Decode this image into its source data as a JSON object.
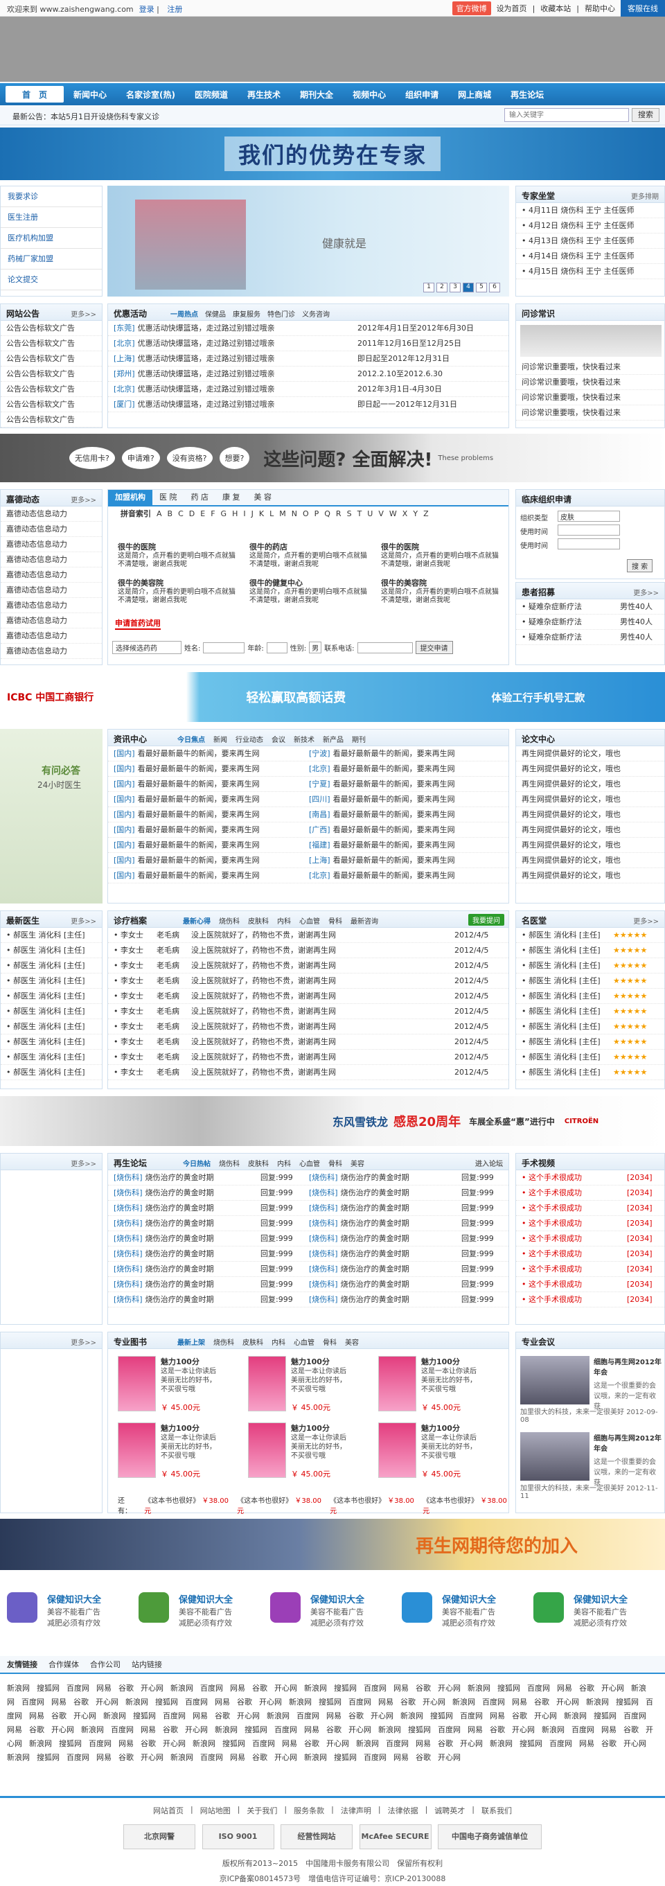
{
  "topbar": {
    "welcome": "欢迎来到 www.zaishengwang.com",
    "login": "登录",
    "register": "注册",
    "weibo": "官方微博",
    "homepage": "设为首页",
    "favorite": "收藏本站",
    "help": "帮助中心",
    "service": "客服在线"
  },
  "nav": [
    "首　页",
    "新闻中心",
    "名家诊室(热)",
    "医院频道",
    "再生技术",
    "期刊大全",
    "视频中心",
    "组织申请",
    "网上商城",
    "再生论坛"
  ],
  "announce": "最新公告：本站5月1日开设烧伤科专家义诊",
  "search": {
    "placeholder": "输入关键字",
    "button": "搜索"
  },
  "hero": "我们的优势在专家",
  "side_menu": [
    "我要求诊",
    "医生注册",
    "医疗机构加盟",
    "药械厂家加盟",
    "论文提交"
  ],
  "slider": {
    "caption": "健康就是",
    "pages": [
      "1",
      "2",
      "3",
      "4",
      "5",
      "6"
    ]
  },
  "expert": {
    "title": "专家坐堂",
    "tab2": "更多排期",
    "items": [
      "• 4月11日 烧伤科 王宁 主任医师",
      "• 4月12日 烧伤科 王宁 主任医师",
      "• 4月13日 烧伤科 王宁 主任医师",
      "• 4月14日 烧伤科 王宁 主任医师",
      "• 4月15日 烧伤科 王宁 主任医师"
    ]
  },
  "site_notice": {
    "title": "网站公告",
    "more": "更多>>",
    "items": [
      "公告公告标软文广告",
      "公告公告标软文广告",
      "公告公告标软文广告",
      "公告公告标软文广告",
      "公告公告标软文广告",
      "公告公告标软文广告",
      "公告公告标软文广告"
    ]
  },
  "promo": {
    "title": "优惠活动",
    "tabs": [
      "一周热点",
      "保健品",
      "康复服务",
      "特色门诊",
      "义务咨询"
    ],
    "items": [
      {
        "tag": "[东莞]",
        "text": "优惠活动快爆篮珞，走过路过别错过哦亲",
        "date": "2012年4月1日至2012年6月30日"
      },
      {
        "tag": "[北京]",
        "text": "优惠活动快爆篮珞，走过路过别错过哦亲",
        "date": "2011年12月16日至12月25日"
      },
      {
        "tag": "[上海]",
        "text": "优惠活动快爆篮珞，走过路过别错过哦亲",
        "date": "即日起至2012年12月31日"
      },
      {
        "tag": "[郑州]",
        "text": "优惠活动快爆篮珞，走过路过别错过哦亲",
        "date": "2012.2.10至2012.6.30"
      },
      {
        "tag": "[北京]",
        "text": "优惠活动快爆篮珞，走过路过别错过哦亲",
        "date": "2012年3月1日-4月30日"
      },
      {
        "tag": "[厦门]",
        "text": "优惠活动快爆篮珞，走过路过别错过哦亲",
        "date": "即日起一一2012年12月31日"
      }
    ]
  },
  "qa": {
    "title": "问诊常识",
    "items": [
      "问诊常识重要哦，快快看过来",
      "问诊常识重要哦，快快看过来",
      "问诊常识重要哦，快快看过来",
      "问诊常识重要哦，快快看过来"
    ]
  },
  "ad1": {
    "q1": "无信用卡?",
    "q2": "申请难?",
    "q3": "没有资格?",
    "q4": "想要?",
    "big": "这些问题? 全面解决!",
    "sub": "These problems"
  },
  "jiade": {
    "title": "嘉德动态",
    "more": "更多>>",
    "items": [
      "嘉德动态信息动力",
      "嘉德动态信息动力",
      "嘉德动态信息动力",
      "嘉德动态信息动力",
      "嘉德动态信息动力",
      "嘉德动态信息动力",
      "嘉德动态信息动力",
      "嘉德动态信息动力",
      "嘉德动态信息动力",
      "嘉德动态信息动力"
    ]
  },
  "join": {
    "tabs": [
      "加盟机构",
      "医 院",
      "药 店",
      "康 复",
      "美 容"
    ],
    "index_label": "拼音索引",
    "letters": [
      "A",
      "B",
      "C",
      "D",
      "E",
      "F",
      "G",
      "H",
      "I",
      "J",
      "K",
      "L",
      "M",
      "N",
      "O",
      "P",
      "Q",
      "R",
      "S",
      "T",
      "U",
      "V",
      "W",
      "X",
      "Y",
      "Z"
    ],
    "cells": [
      {
        "t": "很牛的医院",
        "d": "这是简介，点开看的更明白哦不点就猫不清楚哦，谢谢点我呢"
      },
      {
        "t": "很牛的药店",
        "d": "这是简介，点开看的更明白哦不点就猫不清楚哦，谢谢点我呢"
      },
      {
        "t": "很牛的医院",
        "d": "这是简介，点开看的更明白哦不点就猫不清楚哦，谢谢点我呢"
      },
      {
        "t": "很牛的美容院",
        "d": "这是简介，点开看的更明白哦不点就猫不清楚哦，谢谢点我呢"
      },
      {
        "t": "很牛的健复中心",
        "d": "这是简介，点开看的更明白哦不点就猫不清楚哦，谢谢点我呢"
      },
      {
        "t": "很牛的美容院",
        "d": "这是简介，点开看的更明白哦不点就猫不清楚哦，谢谢点我呢"
      }
    ],
    "apply": "申请首药试用",
    "form": {
      "select": "选择候选药药",
      "name": "姓名:",
      "age": "年龄:",
      "gender": "性别:",
      "gender_val": "男",
      "phone": "联系电话:",
      "submit": "提交申请"
    }
  },
  "clinical": {
    "title": "临床组织申请",
    "type_label": "组织类型",
    "type_val": "皮肤",
    "time1": "使用时间",
    "time2": "使用时间",
    "search": "搜 索"
  },
  "recruit": {
    "title": "患者招募",
    "more": "更多>>",
    "items": [
      {
        "t": "• 疑难杂症新疗法",
        "s": "男性40人"
      },
      {
        "t": "• 疑难杂症新疗法",
        "s": "男性40人"
      },
      {
        "t": "• 疑难杂症新疗法",
        "s": "男性40人"
      }
    ]
  },
  "ad2": {
    "bank": "ICBC 中国工商银行",
    "slogan": "轻松赢取高额话费",
    "right": "体验工行手机号汇款"
  },
  "doctor_ad": {
    "text1": "有问必答",
    "text2": "24小时医生"
  },
  "news": {
    "title": "资讯中心",
    "tabs": [
      "今日焦点",
      "新闻",
      "行业动态",
      "会议",
      "新技术",
      "新产品",
      "期刊"
    ],
    "rows": [
      {
        "a": "[国内]",
        "b": "看最好最新最牛的新闻，要来再生网",
        "c": "[宁波]",
        "d": "看最好最新最牛的新闻，要来再生网"
      },
      {
        "a": "[国内]",
        "b": "看最好最新最牛的新闻，要来再生网",
        "c": "[北京]",
        "d": "看最好最新最牛的新闻，要来再生网"
      },
      {
        "a": "[国内]",
        "b": "看最好最新最牛的新闻，要来再生网",
        "c": "[宁夏]",
        "d": "看最好最新最牛的新闻，要来再生网"
      },
      {
        "a": "[国内]",
        "b": "看最好最新最牛的新闻，要来再生网",
        "c": "[四川]",
        "d": "看最好最新最牛的新闻，要来再生网"
      },
      {
        "a": "[国内]",
        "b": "看最好最新最牛的新闻，要来再生网",
        "c": "[南昌]",
        "d": "看最好最新最牛的新闻，要来再生网"
      },
      {
        "a": "[国内]",
        "b": "看最好最新最牛的新闻，要来再生网",
        "c": "[广西]",
        "d": "看最好最新最牛的新闻，要来再生网"
      },
      {
        "a": "[国内]",
        "b": "看最好最新最牛的新闻，要来再生网",
        "c": "[福建]",
        "d": "看最好最新最牛的新闻，要来再生网"
      },
      {
        "a": "[国内]",
        "b": "看最好最新最牛的新闻，要来再生网",
        "c": "[上海]",
        "d": "看最好最新最牛的新闻，要来再生网"
      },
      {
        "a": "[国内]",
        "b": "看最好最新最牛的新闻，要来再生网",
        "c": "[北京]",
        "d": "看最好最新最牛的新闻，要来再生网"
      }
    ]
  },
  "papers": {
    "title": "论文中心",
    "items": [
      "再生网提供最好的论文，哦也",
      "再生网提供最好的论文，哦也",
      "再生网提供最好的论文，哦也",
      "再生网提供最好的论文，哦也",
      "再生网提供最好的论文，哦也",
      "再生网提供最好的论文，哦也",
      "再生网提供最好的论文，哦也",
      "再生网提供最好的论文，哦也",
      "再生网提供最好的论文，哦也"
    ]
  },
  "new_doctors": {
    "title": "最新医生",
    "more": "更多>>",
    "items": [
      "• 郝医生 消化科 [主任]",
      "• 郝医生 消化科 [主任]",
      "• 郝医生 消化科 [主任]",
      "• 郝医生 消化科 [主任]",
      "• 郝医生 消化科 [主任]",
      "• 郝医生 消化科 [主任]",
      "• 郝医生 消化科 [主任]",
      "• 郝医生 消化科 [主任]",
      "• 郝医生 消化科 [主任]",
      "• 郝医生 消化科 [主任]"
    ]
  },
  "diagnosis": {
    "title": "诊疗档案",
    "tabs": [
      "最新心得",
      "烧伤科",
      "皮肤科",
      "内科",
      "心血管",
      "骨科",
      "最新咨询"
    ],
    "ask": "我要提问",
    "rows": [
      {
        "a": "• 李女士",
        "b": "老毛病",
        "c": "没上医院就好了，药物也不贵，谢谢再生网",
        "d": "2012/4/5"
      },
      {
        "a": "• 李女士",
        "b": "老毛病",
        "c": "没上医院就好了，药物也不贵，谢谢再生网",
        "d": "2012/4/5"
      },
      {
        "a": "• 李女士",
        "b": "老毛病",
        "c": "没上医院就好了，药物也不贵，谢谢再生网",
        "d": "2012/4/5"
      },
      {
        "a": "• 李女士",
        "b": "老毛病",
        "c": "没上医院就好了，药物也不贵，谢谢再生网",
        "d": "2012/4/5"
      },
      {
        "a": "• 李女士",
        "b": "老毛病",
        "c": "没上医院就好了，药物也不贵，谢谢再生网",
        "d": "2012/4/5"
      },
      {
        "a": "• 李女士",
        "b": "老毛病",
        "c": "没上医院就好了，药物也不贵，谢谢再生网",
        "d": "2012/4/5"
      },
      {
        "a": "• 李女士",
        "b": "老毛病",
        "c": "没上医院就好了，药物也不贵，谢谢再生网",
        "d": "2012/4/5"
      },
      {
        "a": "• 李女士",
        "b": "老毛病",
        "c": "没上医院就好了，药物也不贵，谢谢再生网",
        "d": "2012/4/5"
      },
      {
        "a": "• 李女士",
        "b": "老毛病",
        "c": "没上医院就好了，药物也不贵，谢谢再生网",
        "d": "2012/4/5"
      },
      {
        "a": "• 李女士",
        "b": "老毛病",
        "c": "没上医院就好了，药物也不贵，谢谢再生网",
        "d": "2012/4/5"
      }
    ]
  },
  "famous": {
    "title": "名医堂",
    "more": "更多>>",
    "items": [
      "• 郝医生 消化科 [主任]",
      "• 郝医生 消化科 [主任]",
      "• 郝医生 消化科 [主任]",
      "• 郝医生 消化科 [主任]",
      "• 郝医生 消化科 [主任]",
      "• 郝医生 消化科 [主任]",
      "• 郝医生 消化科 [主任]",
      "• 郝医生 消化科 [主任]",
      "• 郝医生 消化科 [主任]",
      "• 郝医生 消化科 [主任]"
    ],
    "stars": "★★★★★"
  },
  "ad3": {
    "a": "东风雪铁龙",
    "b": "感恩20周年",
    "c": "车展全系盛“惠”进行中",
    "logo": "CITROËN"
  },
  "left_more1": "更多>>",
  "left_more2": "更多>>",
  "forum": {
    "title": "再生论坛",
    "tabs": [
      "今日热帖",
      "烧伤科",
      "皮肤科",
      "内科",
      "心血管",
      "骨科",
      "美容"
    ],
    "enter": "进入论坛",
    "rows": [
      {
        "a": "[烧伤科]",
        "b": "烧伤治疗的黄金时期",
        "c": "回复:999",
        "d": "[烧伤科]",
        "e": "烧伤治疗的黄金时期",
        "f": "回复:999"
      },
      {
        "a": "[烧伤科]",
        "b": "烧伤治疗的黄金时期",
        "c": "回复:999",
        "d": "[烧伤科]",
        "e": "烧伤治疗的黄金时期",
        "f": "回复:999"
      },
      {
        "a": "[烧伤科]",
        "b": "烧伤治疗的黄金时期",
        "c": "回复:999",
        "d": "[烧伤科]",
        "e": "烧伤治疗的黄金时期",
        "f": "回复:999"
      },
      {
        "a": "[烧伤科]",
        "b": "烧伤治疗的黄金时期",
        "c": "回复:999",
        "d": "[烧伤科]",
        "e": "烧伤治疗的黄金时期",
        "f": "回复:999"
      },
      {
        "a": "[烧伤科]",
        "b": "烧伤治疗的黄金时期",
        "c": "回复:999",
        "d": "[烧伤科]",
        "e": "烧伤治疗的黄金时期",
        "f": "回复:999"
      },
      {
        "a": "[烧伤科]",
        "b": "烧伤治疗的黄金时期",
        "c": "回复:999",
        "d": "[烧伤科]",
        "e": "烧伤治疗的黄金时期",
        "f": "回复:999"
      },
      {
        "a": "[烧伤科]",
        "b": "烧伤治疗的黄金时期",
        "c": "回复:999",
        "d": "[烧伤科]",
        "e": "烧伤治疗的黄金时期",
        "f": "回复:999"
      },
      {
        "a": "[烧伤科]",
        "b": "烧伤治疗的黄金时期",
        "c": "回复:999",
        "d": "[烧伤科]",
        "e": "烧伤治疗的黄金时期",
        "f": "回复:999"
      },
      {
        "a": "[烧伤科]",
        "b": "烧伤治疗的黄金时期",
        "c": "回复:999",
        "d": "[烧伤科]",
        "e": "烧伤治疗的黄金时期",
        "f": "回复:999"
      }
    ]
  },
  "video": {
    "title": "手术视频",
    "items": [
      {
        "t": "• 这个手术很成功",
        "n": "[2034]"
      },
      {
        "t": "• 这个手术很成功",
        "n": "[2034]"
      },
      {
        "t": "• 这个手术很成功",
        "n": "[2034]"
      },
      {
        "t": "• 这个手术很成功",
        "n": "[2034]"
      },
      {
        "t": "• 这个手术很成功",
        "n": "[2034]"
      },
      {
        "t": "• 这个手术很成功",
        "n": "[2034]"
      },
      {
        "t": "• 这个手术很成功",
        "n": "[2034]"
      },
      {
        "t": "• 这个手术很成功",
        "n": "[2034]"
      },
      {
        "t": "• 这个手术很成功",
        "n": "[2034]"
      }
    ]
  },
  "books": {
    "title": "专业图书",
    "tabs": [
      "最新上架",
      "烧伤科",
      "皮肤科",
      "内科",
      "心血管",
      "骨科",
      "美容"
    ],
    "item": {
      "t": "魅力100分",
      "d": "这是一本让你读后美丽无比的好书，不买很亏哦",
      "p": "￥ 45.00元"
    },
    "also_label": "还有：",
    "also": [
      {
        "t": "《这本书也很好》",
        "p": "￥38.00元"
      },
      {
        "t": "《这本书也很好》",
        "p": "￥38.00元"
      },
      {
        "t": "《这本书也很好》",
        "p": "￥38.00元"
      },
      {
        "t": "《这本书也很好》",
        "p": "￥38.00元"
      }
    ]
  },
  "meeting": {
    "title": "专业会议",
    "items": [
      {
        "t": "细胞与再生网2012年年会",
        "d": "这是一个很重要的会议哦，来的一定有收获",
        "l": "加里很大的科技，未来一定很美好",
        "date": "2012-09-08"
      },
      {
        "t": "细胞与再生网2012年年会",
        "d": "这是一个很重要的会议哦，来的一定有收获",
        "l": "加里很大的科技，未来一定很美好",
        "date": "2012-11-11"
      }
    ]
  },
  "ad4": "再生网期待您的加入",
  "tools": [
    {
      "a": "保健知识大全",
      "b": "美容不能看广告",
      "c": "减肥必须有疗效",
      "color": "#6b5fc6"
    },
    {
      "a": "保健知识大全",
      "b": "美容不能看广告",
      "c": "减肥必须有疗效",
      "color": "#4d9b3a"
    },
    {
      "a": "保健知识大全",
      "b": "美容不能看广告",
      "c": "减肥必须有疗效",
      "color": "#9b3fb7"
    },
    {
      "a": "保健知识大全",
      "b": "美容不能看广告",
      "c": "减肥必须有疗效",
      "color": "#2a8fd6"
    },
    {
      "a": "保健知识大全",
      "b": "美容不能看广告",
      "c": "减肥必须有疗效",
      "color": "#35a548"
    }
  ],
  "friends": {
    "tabs": [
      "友情链接",
      "合作媒体",
      "合作公司",
      "站内链接"
    ],
    "words": [
      "新浪网",
      "搜狐网",
      "百度网",
      "网易",
      "谷歌",
      "开心网",
      "新浪网",
      "百度网",
      "网易",
      "谷歌",
      "开心网",
      "新浪网",
      "搜狐网",
      "百度网",
      "网易",
      "谷歌",
      "开心网"
    ]
  },
  "footer": {
    "links": [
      "网站首页",
      "网站地图",
      "关于我们",
      "服务条款",
      "法律声明",
      "法律依据",
      "诚聘英才",
      "联系我们"
    ],
    "badges": [
      "北京网警",
      "ISO 9001",
      "经营性网站",
      "McAfee SECURE",
      "中国电子商务诚信单位"
    ],
    "copyright": "版权所有2013~2015　中国隆用卡服务有限公司　保留所有权利",
    "icp": "京ICP备案08014573号　增值电信许可证编号：京ICP-20130088"
  }
}
